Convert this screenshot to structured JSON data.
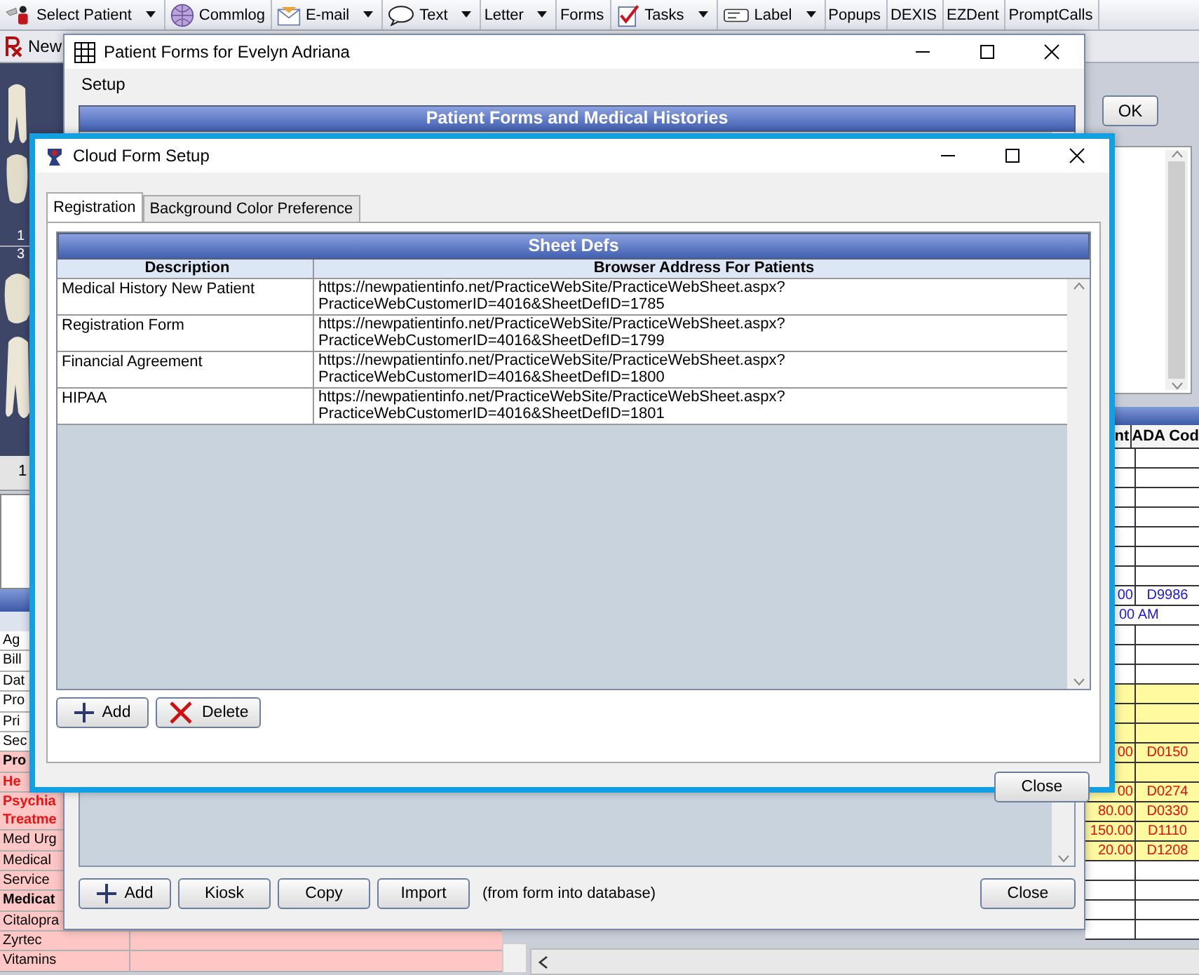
{
  "toolbar": [
    {
      "label": "Select Patient",
      "dropdown": true
    },
    {
      "label": "Commlog",
      "dropdown": false
    },
    {
      "label": "E-mail",
      "dropdown": true
    },
    {
      "label": "Text",
      "dropdown": true
    },
    {
      "label": "Letter",
      "dropdown": true
    },
    {
      "label": "Forms",
      "dropdown": false
    },
    {
      "label": "Tasks",
      "dropdown": true
    },
    {
      "label": "Label",
      "dropdown": true
    },
    {
      "label": "Popups",
      "dropdown": false
    },
    {
      "label": "DEXIS",
      "dropdown": false
    },
    {
      "label": "EZDent",
      "dropdown": false
    },
    {
      "label": "PromptCalls",
      "dropdown": false
    }
  ],
  "second_toolbar": {
    "label": "New"
  },
  "tooth_chart": {
    "numbers": [
      "1",
      "3"
    ],
    "ruler_label": "1"
  },
  "patient_grid": {
    "rows": [
      {
        "label": "Ag",
        "kind": "plain",
        "highlighted": false
      },
      {
        "label": "Bill",
        "kind": "plain",
        "highlighted": false
      },
      {
        "label": "Dat",
        "kind": "plain",
        "highlighted": false
      },
      {
        "label": "Pro",
        "kind": "plain",
        "highlighted": false
      },
      {
        "label": "Pri",
        "kind": "plain",
        "highlighted": false
      },
      {
        "label": "Sec",
        "kind": "plain",
        "highlighted": false
      },
      {
        "label": "Pro",
        "kind": "bold",
        "highlighted": true
      },
      {
        "label": "He",
        "kind": "alert",
        "highlighted": true
      },
      {
        "label": "Psychia\nTreatme",
        "kind": "alert",
        "highlighted": true
      },
      {
        "label": "Med Urg",
        "kind": "plain",
        "highlighted": true
      },
      {
        "label": "Medical",
        "kind": "plain",
        "highlighted": true
      },
      {
        "label": "Service",
        "kind": "plain",
        "highlighted": true
      },
      {
        "label": "Medicat",
        "kind": "bold",
        "highlighted": true
      },
      {
        "label": "Citalopra",
        "kind": "plain",
        "highlighted": true
      },
      {
        "label": "Zyrtec",
        "kind": "plain",
        "highlighted": true
      },
      {
        "label": "Vitamins",
        "kind": "plain",
        "highlighted": true
      }
    ]
  },
  "right_panel": {
    "ok_button": "OK",
    "procedures": {
      "columns": [
        "nt",
        "ADA Cod"
      ],
      "rows": [
        {
          "kind": "plain"
        },
        {
          "kind": "plain"
        },
        {
          "kind": "plain"
        },
        {
          "kind": "plain"
        },
        {
          "kind": "plain"
        },
        {
          "kind": "plain"
        },
        {
          "kind": "plain"
        },
        {
          "kind": "blue",
          "amount": "00",
          "code": "D9986"
        },
        {
          "kind": "blue",
          "note": "00 AM"
        },
        {
          "kind": "plain"
        },
        {
          "kind": "plain"
        },
        {
          "kind": "plain"
        },
        {
          "kind": "yellow"
        },
        {
          "kind": "yellow"
        },
        {
          "kind": "yellow"
        },
        {
          "kind": "yellow",
          "amount": "00",
          "code": "D0150"
        },
        {
          "kind": "yellow"
        },
        {
          "kind": "yellow",
          "amount": "00",
          "code": "D0274"
        },
        {
          "kind": "yellow",
          "amount": "80.00",
          "code": "D0330"
        },
        {
          "kind": "yellow",
          "amount": "150.00",
          "code": "D1110"
        },
        {
          "kind": "yellow",
          "amount": "20.00",
          "code": "D1208"
        },
        {
          "kind": "plain"
        },
        {
          "kind": "plain"
        },
        {
          "kind": "plain"
        },
        {
          "kind": "plain"
        }
      ]
    }
  },
  "patient_forms_window": {
    "title": "Patient Forms for Evelyn Adriana",
    "menu": [
      "Setup"
    ],
    "grid_title": "Patient Forms and Medical Histories",
    "buttons": [
      {
        "label": "Add",
        "kind": "add"
      },
      {
        "label": "Kiosk",
        "kind": "plain"
      },
      {
        "label": "Copy",
        "kind": "plain"
      },
      {
        "label": "Import",
        "kind": "plain"
      }
    ],
    "import_note": "(from form into database)",
    "close_button": "Close"
  },
  "cloud_form_setup": {
    "title": "Cloud Form Setup",
    "tabs": [
      {
        "label": "Registration",
        "selected": true
      },
      {
        "label": "Background Color Preference",
        "selected": false
      }
    ],
    "grid_title": "Sheet Defs",
    "columns": [
      "Description",
      "Browser Address For Patients"
    ],
    "rows": [
      {
        "description": "Medical History New Patient",
        "address": "https://newpatientinfo.net/PracticeWebSite/PracticeWebSheet.aspx?\nPracticeWebCustomerID=4016&SheetDefID=1785"
      },
      {
        "description": "Registration Form",
        "address": "https://newpatientinfo.net/PracticeWebSite/PracticeWebSheet.aspx?\nPracticeWebCustomerID=4016&SheetDefID=1799"
      },
      {
        "description": "Financial Agreement",
        "address": "https://newpatientinfo.net/PracticeWebSite/PracticeWebSheet.aspx?\nPracticeWebCustomerID=4016&SheetDefID=1800"
      },
      {
        "description": "HIPAA",
        "address": "https://newpatientinfo.net/PracticeWebSite/PracticeWebSheet.aspx?\nPracticeWebCustomerID=4016&SheetDefID=1801"
      }
    ],
    "buttons": [
      {
        "label": "Add",
        "kind": "add"
      },
      {
        "label": "Delete",
        "kind": "delete"
      }
    ],
    "close_button": "Close"
  }
}
